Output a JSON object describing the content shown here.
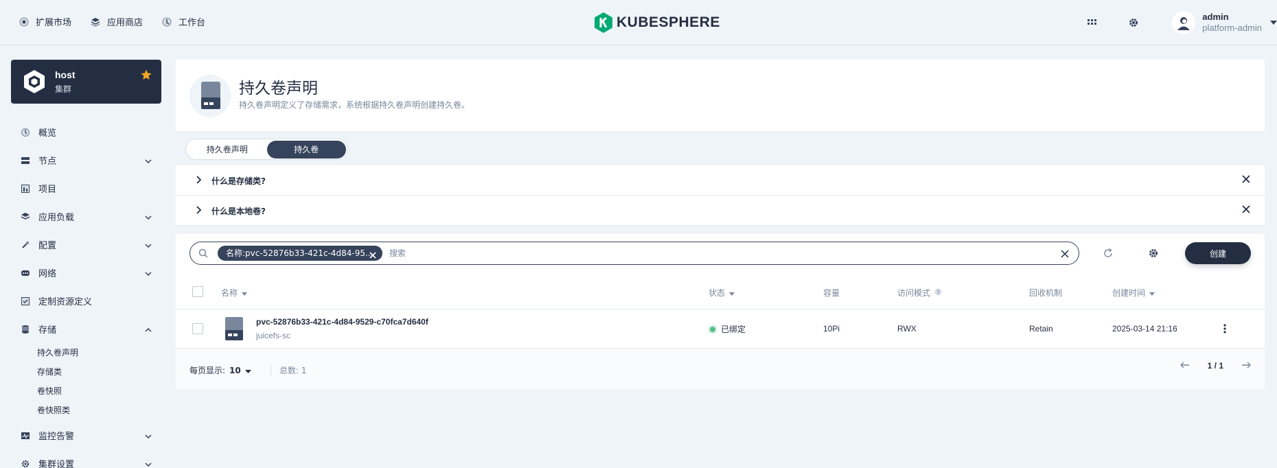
{
  "topnav": [
    {
      "label": "扩展市场",
      "icon": "extensions-icon"
    },
    {
      "label": "应用商店",
      "icon": "app-store-icon"
    },
    {
      "label": "工作台",
      "icon": "workbench-icon"
    }
  ],
  "brand": {
    "name": "KUBESPHERE",
    "accent": "#00aa72"
  },
  "user": {
    "name": "admin",
    "role": "platform-admin"
  },
  "cluster": {
    "name": "host",
    "type": "集群"
  },
  "sidebar": {
    "items": [
      {
        "label": "概览",
        "icon": "dashboard-icon"
      },
      {
        "label": "节点",
        "icon": "nodes-icon"
      },
      {
        "label": "项目",
        "icon": "projects-icon"
      },
      {
        "label": "应用负载",
        "icon": "workloads-icon"
      },
      {
        "label": "配置",
        "icon": "config-icon"
      },
      {
        "label": "网络",
        "icon": "network-icon"
      },
      {
        "label": "定制资源定义",
        "icon": "crd-icon"
      },
      {
        "label": "存储",
        "icon": "storage-icon"
      },
      {
        "label": "监控告警",
        "icon": "monitoring-icon"
      },
      {
        "label": "集群设置",
        "icon": "cluster-settings-icon"
      }
    ],
    "storage_sub": [
      "持久卷声明",
      "存储类",
      "卷快照",
      "卷快照类"
    ]
  },
  "page": {
    "title": "持久卷声明",
    "description": "持久卷声明定义了存储需求，系统根据持久卷声明创建持久卷。",
    "tabs": [
      "持久卷声明",
      "持久卷"
    ],
    "active_tab": "持久卷"
  },
  "faq": [
    "什么是存储类?",
    "什么是本地卷?"
  ],
  "search": {
    "chip": "名称:pvc-52876b33-421c-4d84-95...",
    "placeholder": "搜索"
  },
  "toolbar": {
    "create_label": "创建"
  },
  "table": {
    "columns": {
      "name": "名称",
      "status": "状态",
      "capacity": "容量",
      "access_mode": "访问模式",
      "reclaim": "回收机制",
      "created": "创建时间"
    },
    "rows": [
      {
        "name": "pvc-52876b33-421c-4d84-9529-c70fca7d640f",
        "storage_class": "juicefs-sc",
        "status": "已绑定",
        "capacity": "10Pi",
        "access_mode": "RWX",
        "reclaim": "Retain",
        "created": "2025-03-14 21:16"
      }
    ]
  },
  "pagination": {
    "per_page_label": "每页显示:",
    "per_page": "10",
    "total_label": "总数: 1",
    "page": "1 / 1"
  }
}
